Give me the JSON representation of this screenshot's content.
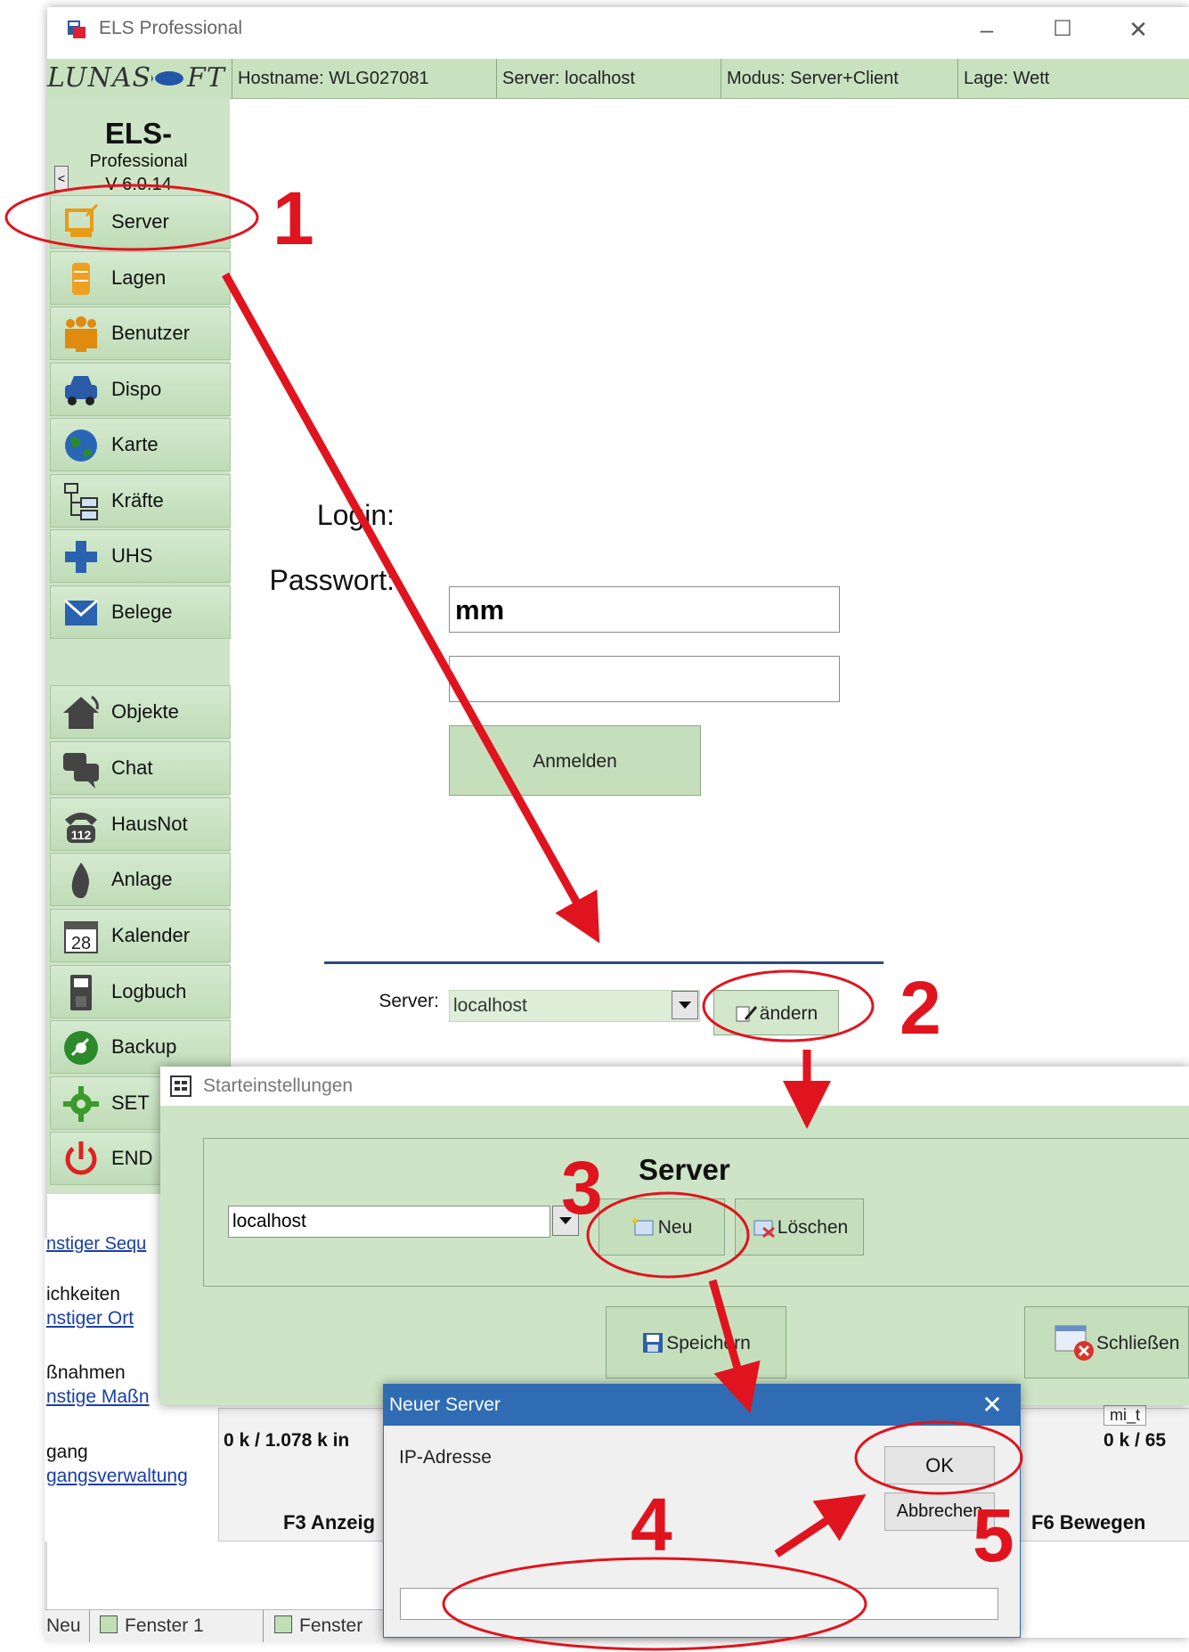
{
  "window": {
    "title": "ELS Professional",
    "minimize": "–",
    "maximize": "☐",
    "close": "✕"
  },
  "infobar": {
    "logo": "LUNAS",
    "logo_suffix": "FT",
    "hostname": "Hostname: WLG027081",
    "server": "Server: localhost",
    "modus": "Modus: Server+Client",
    "lage": "Lage: Wett"
  },
  "sidebar": {
    "app_title": "ELS-",
    "app_sub": "Professional",
    "version": "V 6.0.14",
    "collapse": "<",
    "items": [
      {
        "label": "Server",
        "icon": "monitor-icon"
      },
      {
        "label": "Lagen",
        "icon": "stack-icon"
      },
      {
        "label": "Benutzer",
        "icon": "users-icon"
      },
      {
        "label": "Dispo",
        "icon": "car-icon"
      },
      {
        "label": "Karte",
        "icon": "globe-icon"
      },
      {
        "label": "Kräfte",
        "icon": "tree-icon"
      },
      {
        "label": "UHS",
        "icon": "plus-icon"
      },
      {
        "label": "Belege",
        "icon": "envelope-icon"
      },
      {
        "label": "Objekte",
        "icon": "house-icon"
      },
      {
        "label": "Chat",
        "icon": "chat-icon"
      },
      {
        "label": "HausNot",
        "icon": "phone-112-icon"
      },
      {
        "label": "Anlage",
        "icon": "flame-icon"
      },
      {
        "label": "Kalender",
        "icon": "calendar-icon"
      },
      {
        "label": "Logbuch",
        "icon": "book-icon"
      },
      {
        "label": "Backup",
        "icon": "disc-icon"
      },
      {
        "label": "SET",
        "icon": "gear-icon"
      },
      {
        "label": "END",
        "icon": "power-icon"
      }
    ],
    "calendar_day": "28",
    "phone_number": "112"
  },
  "login": {
    "login_label": "Login:",
    "login_value": "mm",
    "password_label": "Passwort:",
    "submit": "Anmelden",
    "server_label": "Server:",
    "server_value": "localhost",
    "change": "ändern"
  },
  "background_panel": {
    "link1": "nstiger Sequ",
    "heading2": "ichkeiten",
    "link2": "nstiger Ort",
    "heading3": "ßnahmen",
    "link3": "nstige Maßn",
    "heading4": "gang",
    "link4": "gangsverwaltung",
    "status_left": "0 k / 1.078 k in",
    "status_right": "0 k / 65",
    "file_tab": "mi_t",
    "f3": "F3 Anzeig",
    "f6": "F6 Bewegen",
    "taskbar_new": "Neu",
    "taskbar_w1": "Fenster 1",
    "taskbar_w2": "Fenster"
  },
  "start_dialog": {
    "title": "Starteinstellungen",
    "heading": "Server",
    "server_value": "localhost",
    "new": "Neu",
    "delete": "Löschen",
    "save": "Speichern",
    "close": "Schließen"
  },
  "new_server_dialog": {
    "title": "Neuer Server",
    "close": "✕",
    "ip_label": "IP-Adresse",
    "ok": "OK",
    "cancel": "Abbrechen",
    "ip_value": ""
  },
  "annotations": {
    "step1": "1",
    "step2": "2",
    "step3": "3",
    "step4": "4",
    "step5": "5",
    "color": "#e0141e"
  }
}
